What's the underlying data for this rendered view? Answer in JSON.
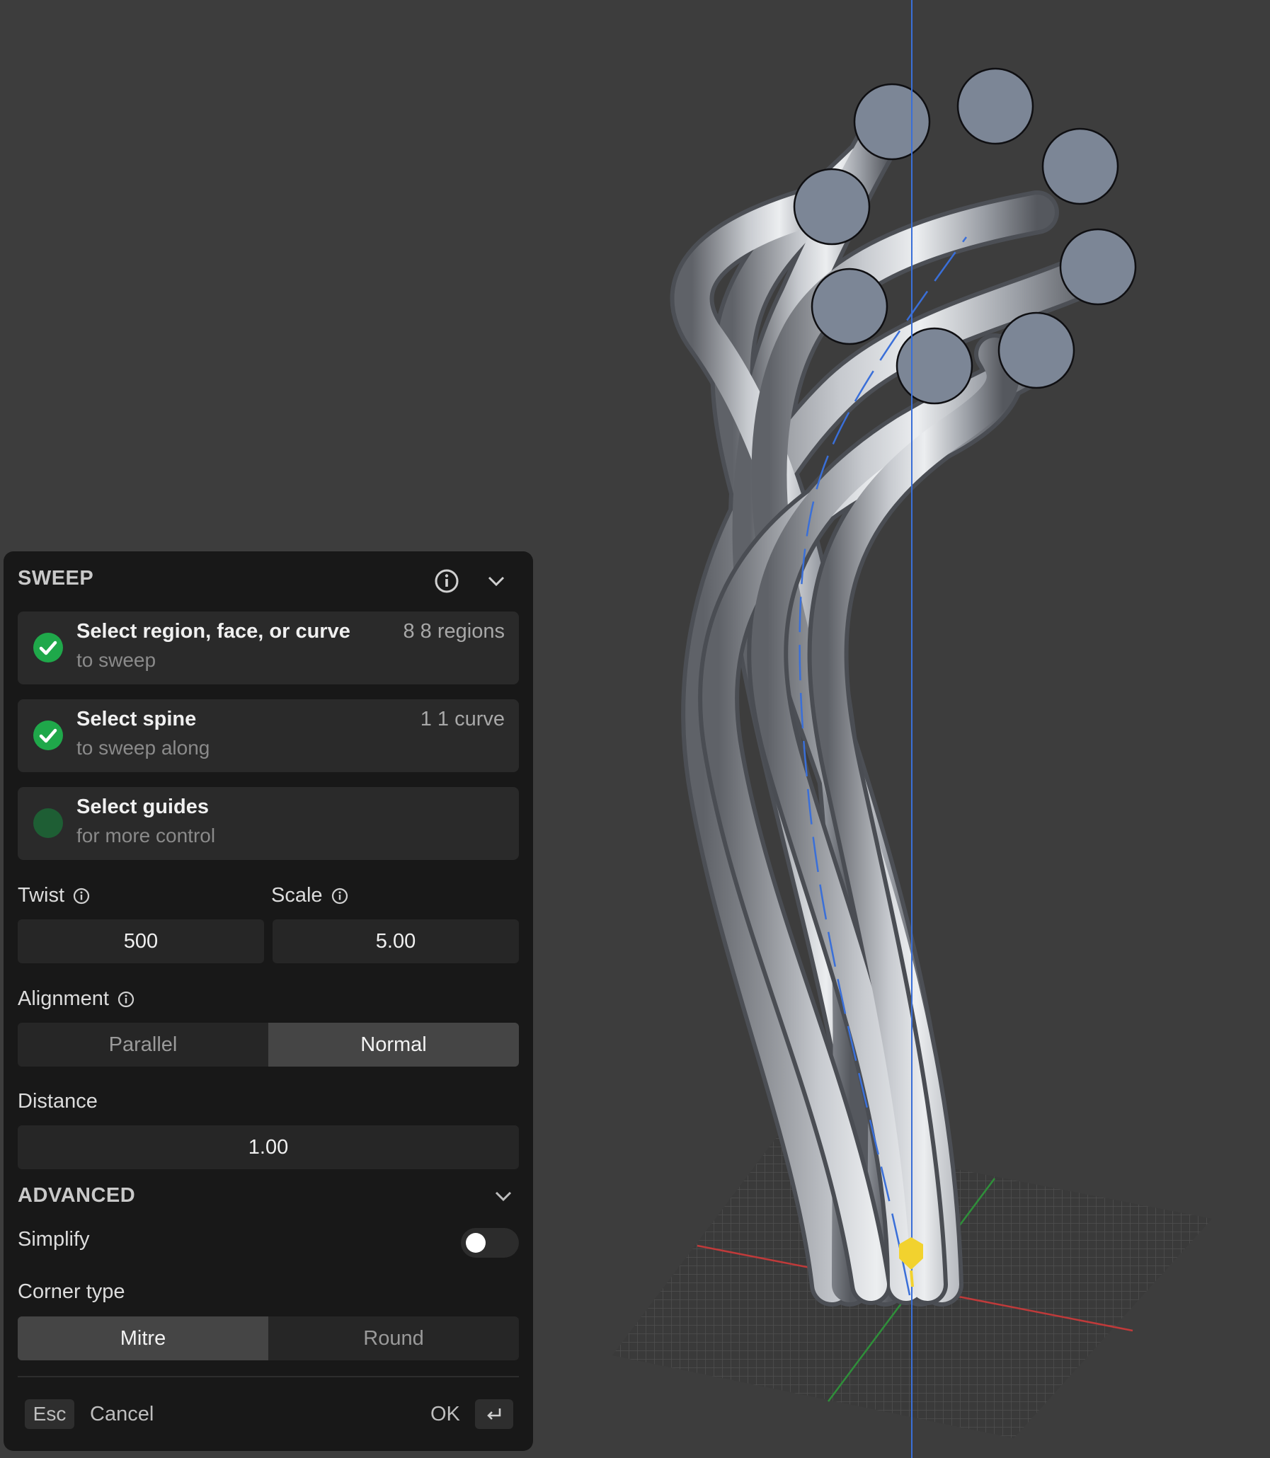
{
  "panel": {
    "title": "SWEEP",
    "steps": [
      {
        "title": "Select region, face, or curve",
        "subtitle": "to sweep",
        "count": "8 8 regions",
        "done": true
      },
      {
        "title": "Select spine",
        "subtitle": "to sweep along",
        "count": "1 1 curve",
        "done": true
      },
      {
        "title": "Select guides",
        "subtitle": "for more control",
        "count": "",
        "done": false
      }
    ],
    "twist": {
      "label": "Twist",
      "value": "500"
    },
    "scale": {
      "label": "Scale",
      "value": "5.00"
    },
    "alignment": {
      "label": "Alignment",
      "options": [
        "Parallel",
        "Normal"
      ],
      "selected": "Normal"
    },
    "distance": {
      "label": "Distance",
      "value": "1.00"
    },
    "advanced": {
      "title": "ADVANCED",
      "simplify": {
        "label": "Simplify",
        "on": false
      },
      "corner_type": {
        "label": "Corner type",
        "options": [
          "Mitre",
          "Round"
        ],
        "selected": "Mitre"
      }
    },
    "footer": {
      "esc_key": "Esc",
      "cancel": "Cancel",
      "ok": "OK",
      "enter_key": "↵"
    }
  },
  "colors": {
    "background": "#3d3d3d",
    "panel": "#181818",
    "success": "#1fa84a",
    "axis_vertical": "#3a6fd8",
    "axis_x": "#c03a3a",
    "axis_y": "#2f8f3a",
    "gizmo": "#f2d22e",
    "profile_fill": "#7c8696"
  },
  "icons": [
    "info-icon",
    "chevron-down-icon",
    "check-icon",
    "enter-key-icon"
  ]
}
